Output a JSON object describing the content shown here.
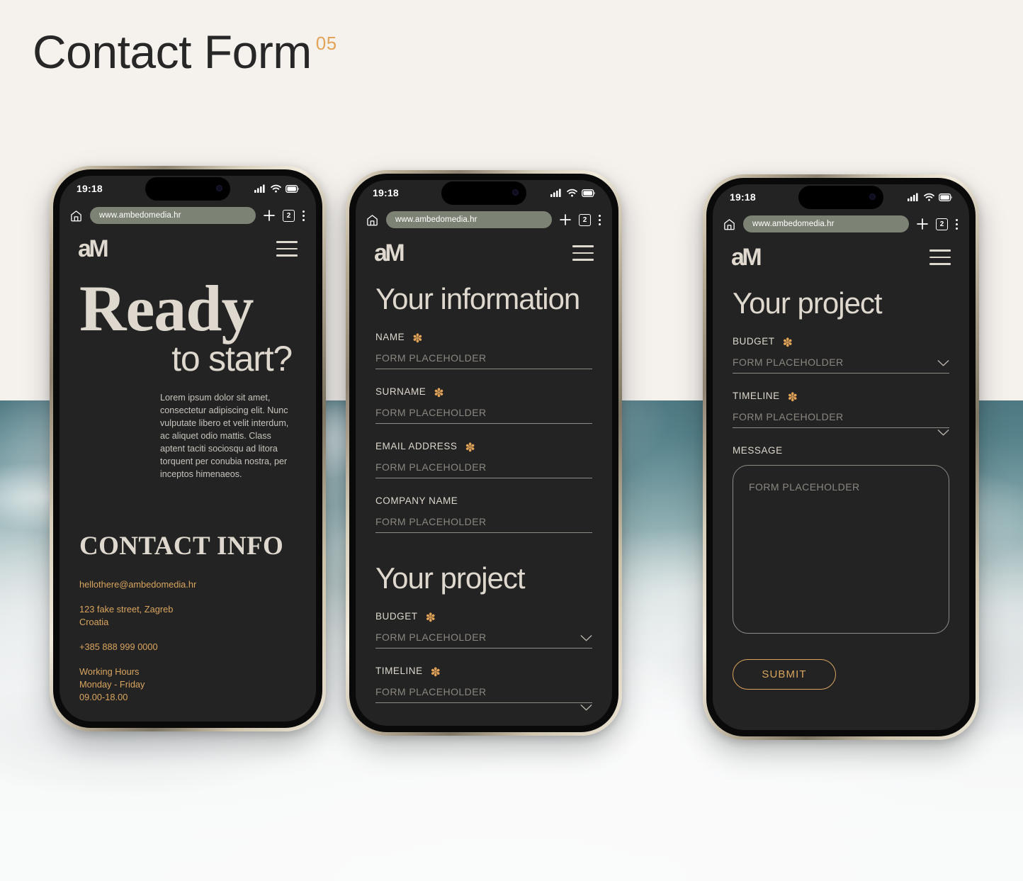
{
  "page": {
    "title": "Contact Form",
    "number": "05",
    "accent_color": "#e3a458",
    "gold_color": "#d9a55e",
    "cream_color": "#ded8ce",
    "screen_bg": "#232323",
    "canvas_bg": "#f5f1ed"
  },
  "browser": {
    "time": "19:18",
    "url": "www.ambedomedia.hr",
    "tab_count": "2",
    "icons": {
      "signal": "signal-bars-icon",
      "wifi": "wifi-icon",
      "battery": "battery-icon",
      "home": "home-icon",
      "new_tab": "plus-icon",
      "tabs": "tab-count-icon",
      "menu": "kebab-menu-icon"
    }
  },
  "site_header": {
    "logo_a": "a",
    "logo_m": "M",
    "menu_icon": "hamburger-menu-icon"
  },
  "screen1": {
    "hero_line1": "Ready",
    "hero_line2": "to start?",
    "paragraph": "Lorem ipsum dolor sit amet, consectetur adipiscing elit. Nunc vulputate libero et velit interdum, ac aliquet odio mattis. Class aptent taciti sociosqu ad litora torquent per conubia nostra, per inceptos himenaeos.",
    "contact_heading": "CONTACT INFO",
    "contact_email": "hellothere@ambedomedia.hr",
    "contact_address_line1": "123 fake street, Zagreb",
    "contact_address_line2": "Croatia",
    "contact_phone": "+385 888 999 0000",
    "hours_title": "Working Hours",
    "hours_days": "Monday - Friday",
    "hours_time": "09.00-18.00"
  },
  "screen2": {
    "heading_info": "Your information",
    "heading_project": "Your project",
    "fields": [
      {
        "label": "NAME",
        "required": true,
        "placeholder": "FORM PLACEHOLDER",
        "type": "text"
      },
      {
        "label": "SURNAME",
        "required": true,
        "placeholder": "FORM PLACEHOLDER",
        "type": "text"
      },
      {
        "label": "EMAIL ADDRESS",
        "required": true,
        "placeholder": "FORM PLACEHOLDER",
        "type": "text"
      },
      {
        "label": "COMPANY NAME",
        "required": false,
        "placeholder": "FORM PLACEHOLDER",
        "type": "text"
      },
      {
        "label": "BUDGET",
        "required": true,
        "placeholder": "FORM PLACEHOLDER",
        "type": "select"
      },
      {
        "label": "TIMELINE",
        "required": true,
        "placeholder": "FORM PLACEHOLDER",
        "type": "select"
      }
    ]
  },
  "screen3": {
    "heading_project": "Your project",
    "budget_label": "BUDGET",
    "budget_placeholder": "FORM PLACEHOLDER",
    "timeline_label": "TIMELINE",
    "timeline_placeholder": "FORM PLACEHOLDER",
    "message_label": "MESSAGE",
    "message_placeholder": "FORM PLACEHOLDER",
    "submit_label": "SUBMIT",
    "required_marker": "✽"
  }
}
